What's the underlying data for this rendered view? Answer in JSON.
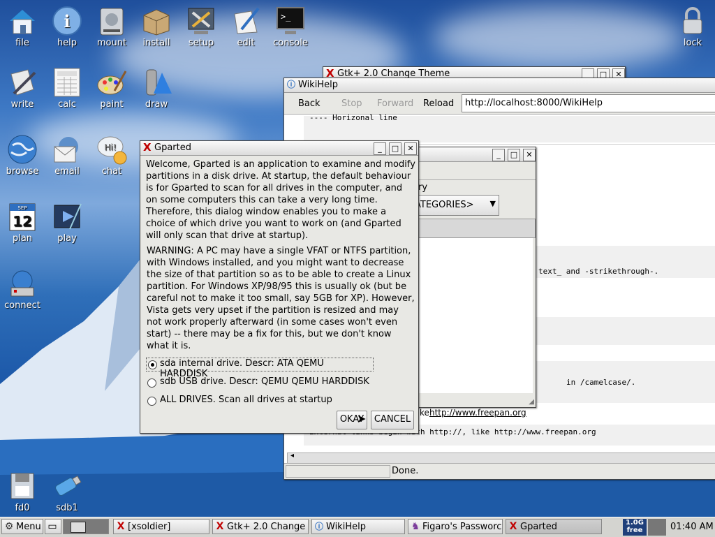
{
  "desktop_icons": [
    {
      "label": "file",
      "icon": "home-folder-icon"
    },
    {
      "label": "help",
      "icon": "info-icon"
    },
    {
      "label": "mount",
      "icon": "drive-icon"
    },
    {
      "label": "install",
      "icon": "package-icon"
    },
    {
      "label": "setup",
      "icon": "tools-icon"
    },
    {
      "label": "edit",
      "icon": "pen-icon"
    },
    {
      "label": "console",
      "icon": "terminal-icon"
    },
    {
      "label": "lock",
      "icon": "padlock-icon"
    },
    {
      "label": "write",
      "icon": "writer-icon"
    },
    {
      "label": "calc",
      "icon": "spreadsheet-icon"
    },
    {
      "label": "paint",
      "icon": "palette-icon"
    },
    {
      "label": "draw",
      "icon": "draw-icon"
    },
    {
      "label": "browse",
      "icon": "globe-icon"
    },
    {
      "label": "email",
      "icon": "mail-icon"
    },
    {
      "label": "chat",
      "icon": "chat-bubble-icon"
    },
    {
      "label": "plan",
      "icon": "calendar-icon"
    },
    {
      "label": "play",
      "icon": "video-icon"
    },
    {
      "label": "connect",
      "icon": "network-icon"
    },
    {
      "label": "fd0",
      "icon": "floppy-icon"
    },
    {
      "label": "sdb1",
      "icon": "usb-icon"
    }
  ],
  "calendar_icon": {
    "month": "SEP",
    "day": "12"
  },
  "chat_icon_text": "Hi!",
  "gtk_theme_window": {
    "title": "Gtk+ 2.0 Change Theme"
  },
  "wikihelp": {
    "title": "WikiHelp",
    "back": "Back",
    "stop": "Stop",
    "forward": "Forward",
    "reload": "Reload",
    "url": "http://localhost:8000/WikiHelp",
    "line1": "---- Horizonal line",
    "line2": "text_ and -strikethrough-.",
    "line3": "in /camelcase/.",
    "link_prefix": "ke",
    "link": "http://www.freepan.org",
    "line4": "External links begin with http://, like http://www.freepan.org",
    "status": "Done."
  },
  "figaro_window": {
    "row1": "ry",
    "dropdown": "ATEGORIES>"
  },
  "gparted": {
    "title": "Gparted",
    "intro": "Welcome, Gparted is an application to examine and modify partitions in a disk drive. At startup, the default behaviour is for Gparted to scan for all drives in the computer, and on some computers this can take a very long time. Therefore, this dialog window enables you to make a choice of which drive you want to work on (and Gparted will only scan that drive at startup).",
    "warning": "WARNING: A PC may have a single VFAT or NTFS partition, with Windows installed, and you might want to decrease the size of that partition so as to be able to create a Linux partition. For Windows XP/98/95 this is usually ok (but be careful not to make it too small, say 5GB for XP). However, Vista gets very upset if the partition is resized and may not work properly afterward (in some cases won't even start) -- there may be a fix for this, but we don't know what it is.",
    "options": [
      {
        "label": "sda internal drive. Descr: ATA QEMU HARDDISK",
        "selected": true
      },
      {
        "label": "sdb USB drive. Descr: QEMU QEMU HARDDISK",
        "selected": false
      },
      {
        "label": "ALL DRIVES. Scan all drives at startup",
        "selected": false
      }
    ],
    "ok": "OKAY",
    "cancel": "CANCEL"
  },
  "taskbar": {
    "menu": "Menu",
    "tasks": [
      "[xsoldier]",
      "Gtk+ 2.0 Change",
      "WikiHelp",
      "Figaro's Passworc",
      "Gparted"
    ],
    "badge_top": "1.0G",
    "badge_bottom": "free",
    "clock": "01:40 AM"
  }
}
